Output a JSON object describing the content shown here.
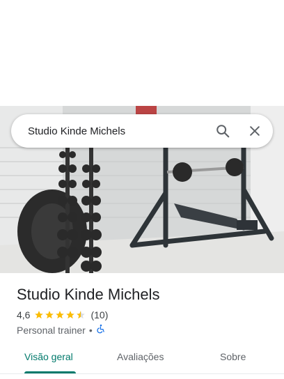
{
  "search": {
    "query": "Studio Kinde Michels"
  },
  "place": {
    "name": "Studio Kinde Michels",
    "rating": "4,6",
    "stars": 4.6,
    "reviews": "(10)",
    "category": "Personal trainer",
    "separator": "•",
    "accessibility_icon": "wheelchair-icon"
  },
  "tabs": [
    {
      "label": "Visão geral",
      "active": true
    },
    {
      "label": "Avaliações",
      "active": false
    },
    {
      "label": "Sobre",
      "active": false
    }
  ],
  "colors": {
    "accent": "#00796b",
    "star": "#fbbc04",
    "accessible": "#1a73e8"
  }
}
